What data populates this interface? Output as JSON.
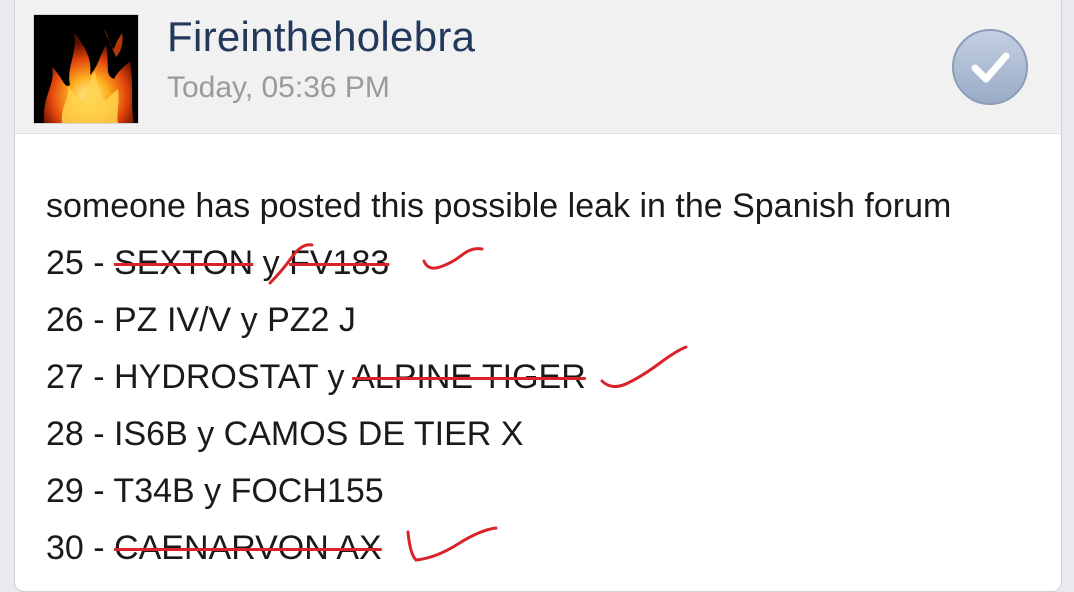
{
  "post": {
    "username": "Fireintheholebra",
    "timestamp": "Today, 05:36 PM",
    "intro": "someone has posted this possible leak in the Spanish forum",
    "lines": [
      {
        "num": "25 - ",
        "a": "SEXTON",
        "a_struck": true,
        "sep": " y ",
        "b": "FV183",
        "b_struck": true
      },
      {
        "num": "26 - ",
        "a": "PZ IV/V",
        "a_struck": false,
        "sep": " y ",
        "b": "PZ2 J",
        "b_struck": false
      },
      {
        "num": "27 - ",
        "a": "HYDROSTAT",
        "a_struck": false,
        "sep": " y ",
        "b": "ALPINE TIGER",
        "b_struck": true
      },
      {
        "num": "28 - ",
        "a": "IS6B",
        "a_struck": false,
        "sep": " y ",
        "b": "CAMOS DE TIER X",
        "b_struck": false
      },
      {
        "num": "29 - ",
        "a": "T34B",
        "a_struck": false,
        "sep": " y ",
        "b": "FOCH155",
        "b_struck": false
      },
      {
        "num": "30 - ",
        "a": "CAENARVON AX",
        "a_struck": true,
        "sep": "",
        "b": "",
        "b_struck": false
      }
    ]
  },
  "icons": {
    "avatar": "fire-avatar",
    "check": "checkmark-icon"
  },
  "colors": {
    "username": "#23395b",
    "timestamp": "#9a9a9a",
    "strike": "#d8232a",
    "check_bg": "#aebdd4"
  }
}
